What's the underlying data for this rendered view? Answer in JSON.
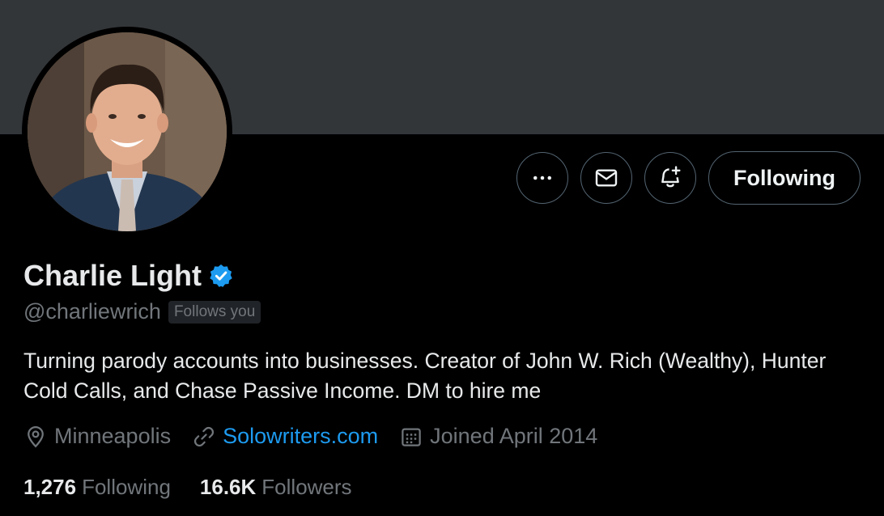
{
  "profile": {
    "display_name": "Charlie Light",
    "handle": "@charliewrich",
    "follows_you": "Follows you",
    "bio": "Turning parody accounts into businesses. Creator of John W. Rich (Wealthy), Hunter Cold Calls, and Chase Passive Income. DM to hire me",
    "location": "Minneapolis",
    "website": "Solowriters.com",
    "joined": "Joined April 2014",
    "verified": true
  },
  "actions": {
    "more_icon": "more-icon",
    "message_icon": "mail-icon",
    "notify_icon": "bell-plus-icon",
    "follow_label": "Following"
  },
  "stats": {
    "following_count": "1,276",
    "following_label": "Following",
    "followers_count": "16.6K",
    "followers_label": "Followers"
  },
  "colors": {
    "background": "#000000",
    "banner": "#333639",
    "accent": "#1d9bf0",
    "secondary_text": "#71767b",
    "primary_text": "#e7e9ea"
  }
}
